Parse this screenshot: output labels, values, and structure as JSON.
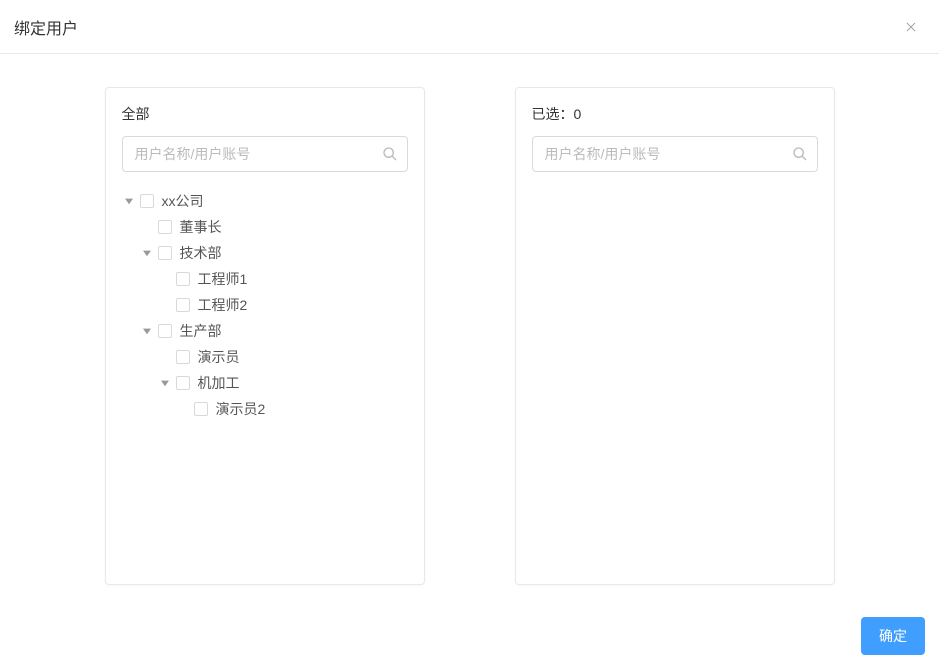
{
  "modal": {
    "title": "绑定用户"
  },
  "leftPanel": {
    "title": "全部",
    "searchPlaceholder": "用户名称/用户账号"
  },
  "rightPanel": {
    "titlePrefix": "已选：",
    "selectedCount": "0",
    "searchPlaceholder": "用户名称/用户账号"
  },
  "tree": {
    "n0": "xx公司",
    "n0_0": "董事长",
    "n0_1": "技术部",
    "n0_1_0": "工程师1",
    "n0_1_1": "工程师2",
    "n0_2": "生产部",
    "n0_2_0": "演示员",
    "n0_2_1": "机加工",
    "n0_2_1_0": "演示员2"
  },
  "footer": {
    "confirm": "确定"
  }
}
